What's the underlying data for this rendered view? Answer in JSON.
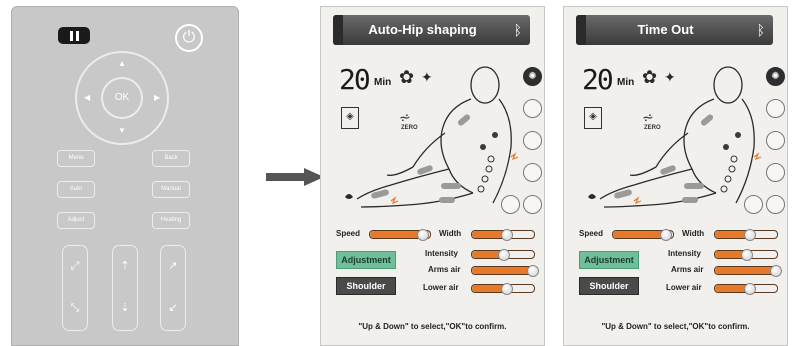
{
  "remote": {
    "ok_label": "OK",
    "buttons": [
      {
        "label": "Menu"
      },
      {
        "label": "Back"
      },
      {
        "label": "Auto"
      },
      {
        "label": "Manual"
      },
      {
        "label": "Adjust"
      },
      {
        "label": "Heating"
      }
    ]
  },
  "screens": [
    {
      "title": "Auto-Hip shaping",
      "timer": "20",
      "timer_unit": "Min",
      "zero_label": "ZERO",
      "sliders": {
        "speed": {
          "label": "Speed",
          "level": 0.85
        },
        "width": {
          "label": "Width",
          "level": 0.55
        },
        "intensity": {
          "label": "Intensity",
          "level": 0.5
        },
        "arms_air": {
          "label": "Arms air",
          "level": 0.95
        },
        "lower_air": {
          "label": "Lower air",
          "level": 0.55
        }
      },
      "adjustment_label": "Adjustment",
      "shoulder_label": "Shoulder",
      "hint": "\"Up & Down\" to select,\"OK\"to confirm."
    },
    {
      "title": "Time Out",
      "timer": "20",
      "timer_unit": "Min",
      "zero_label": "ZERO",
      "sliders": {
        "speed": {
          "label": "Speed",
          "level": 0.85
        },
        "width": {
          "label": "Width",
          "level": 0.55
        },
        "intensity": {
          "label": "Intensity",
          "level": 0.5
        },
        "arms_air": {
          "label": "Arms air",
          "level": 0.95
        },
        "lower_air": {
          "label": "Lower air",
          "level": 0.55
        }
      },
      "adjustment_label": "Adjustment",
      "shoulder_label": "Shoulder",
      "hint": "\"Up & Down\" to select,\"OK\"to confirm."
    }
  ],
  "colors": {
    "accent": "#e8792b",
    "adjust_green": "#6fbf9a",
    "dark": "#3a3a3a"
  }
}
